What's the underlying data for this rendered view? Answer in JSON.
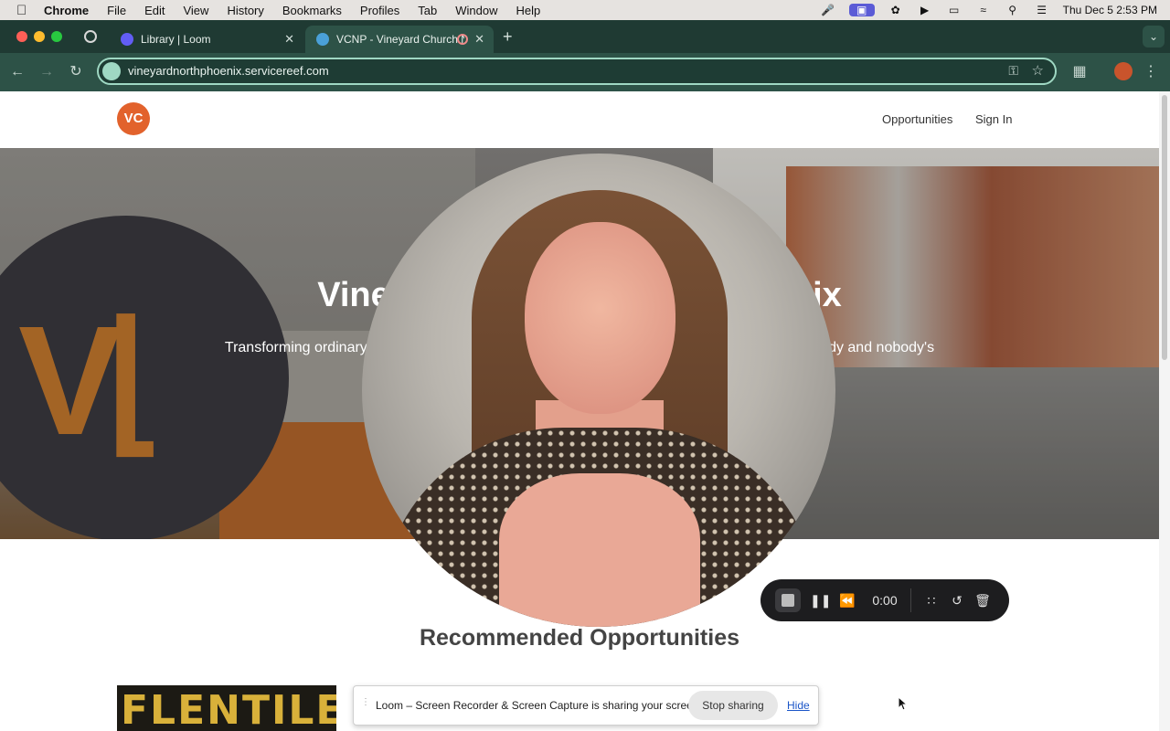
{
  "menubar": {
    "app": "Chrome",
    "items": [
      "File",
      "Edit",
      "View",
      "History",
      "Bookmarks",
      "Profiles",
      "Tab",
      "Window",
      "Help"
    ],
    "clock": "Thu Dec 5  2:53 PM"
  },
  "tabs": [
    {
      "label": "Library | Loom",
      "active": false
    },
    {
      "label": "VCNP - Vineyard Church N",
      "active": true
    }
  ],
  "omnibox": {
    "url": "vineyardnorthphoenix.servicereef.com"
  },
  "site": {
    "logo_text": "VC",
    "nav": {
      "opportunities": "Opportunities",
      "sign_in": "Sign In"
    },
    "hero": {
      "title": "Vineyard Church North Phoenix",
      "subtitle": "Transforming ordinary people into fully devoted followers of Christ where everyone is somebody and nobody's"
    },
    "section_title": "Recommended Opportunities",
    "card_thumb_text": "FLENTILES"
  },
  "loom": {
    "timer": "0:00"
  },
  "share_bar": {
    "message": "Loom – Screen Recorder & Screen Capture is sharing your screen.",
    "stop_label": "Stop sharing",
    "hide_label": "Hide"
  },
  "colors": {
    "brand": "#e2622c",
    "chrome_dark": "#1f3a33",
    "chrome_toolbar": "#2d5247",
    "omnibox_border": "#9fd8c3"
  }
}
